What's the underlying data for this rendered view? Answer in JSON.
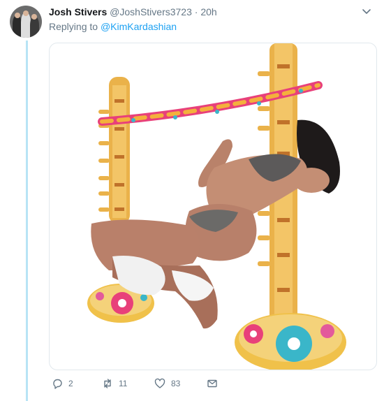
{
  "tweet": {
    "display_name": "Josh Stivers",
    "username": "@JoshStivers3723",
    "separator": "·",
    "timestamp": "20h",
    "replying_prefix": "Replying to",
    "replying_handle": "@KimKardashian"
  },
  "actions": {
    "reply_count": "2",
    "retweet_count": "11",
    "like_count": "83"
  },
  "icons": [
    "chevron-down-icon",
    "reply-icon",
    "retweet-icon",
    "like-icon",
    "message-icon"
  ],
  "colors": {
    "accent": "#1da1f2",
    "thread_line": "#b8e4f5",
    "meta_text": "#657786",
    "name_text": "#14171a"
  }
}
